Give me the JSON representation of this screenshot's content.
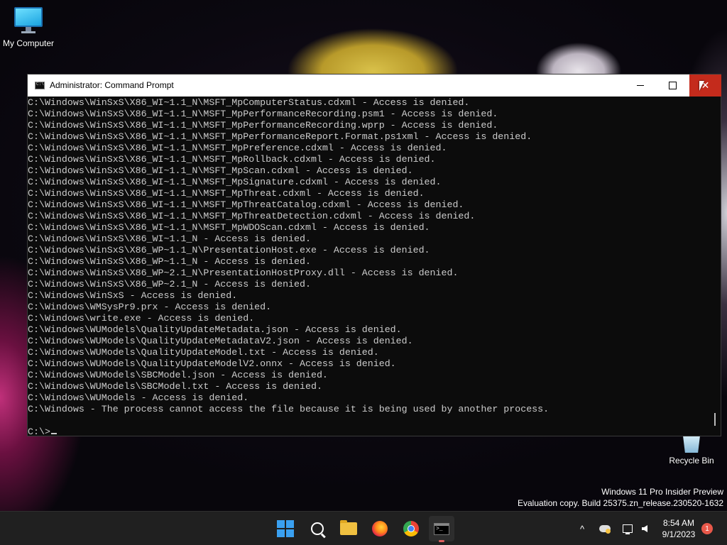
{
  "desktop": {
    "icons": [
      {
        "label": "My Computer"
      },
      {
        "label": "Recycle Bin"
      }
    ],
    "watermark": {
      "line1": "Windows 11 Pro Insider Preview",
      "line2": "Evaluation copy. Build 25375.zn_release.230520-1632"
    }
  },
  "window": {
    "title": "Administrator: Command Prompt",
    "console_lines": [
      "C:\\Windows\\WinSxS\\X86_WI~1.1_N\\MSFT_MpComputerStatus.cdxml - Access is denied.",
      "C:\\Windows\\WinSxS\\X86_WI~1.1_N\\MSFT_MpPerformanceRecording.psm1 - Access is denied.",
      "C:\\Windows\\WinSxS\\X86_WI~1.1_N\\MSFT_MpPerformanceRecording.wprp - Access is denied.",
      "C:\\Windows\\WinSxS\\X86_WI~1.1_N\\MSFT_MpPerformanceReport.Format.ps1xml - Access is denied.",
      "C:\\Windows\\WinSxS\\X86_WI~1.1_N\\MSFT_MpPreference.cdxml - Access is denied.",
      "C:\\Windows\\WinSxS\\X86_WI~1.1_N\\MSFT_MpRollback.cdxml - Access is denied.",
      "C:\\Windows\\WinSxS\\X86_WI~1.1_N\\MSFT_MpScan.cdxml - Access is denied.",
      "C:\\Windows\\WinSxS\\X86_WI~1.1_N\\MSFT_MpSignature.cdxml - Access is denied.",
      "C:\\Windows\\WinSxS\\X86_WI~1.1_N\\MSFT_MpThreat.cdxml - Access is denied.",
      "C:\\Windows\\WinSxS\\X86_WI~1.1_N\\MSFT_MpThreatCatalog.cdxml - Access is denied.",
      "C:\\Windows\\WinSxS\\X86_WI~1.1_N\\MSFT_MpThreatDetection.cdxml - Access is denied.",
      "C:\\Windows\\WinSxS\\X86_WI~1.1_N\\MSFT_MpWDOScan.cdxml - Access is denied.",
      "C:\\Windows\\WinSxS\\X86_WI~1.1_N - Access is denied.",
      "C:\\Windows\\WinSxS\\X86_WP~1.1_N\\PresentationHost.exe - Access is denied.",
      "C:\\Windows\\WinSxS\\X86_WP~1.1_N - Access is denied.",
      "C:\\Windows\\WinSxS\\X86_WP~2.1_N\\PresentationHostProxy.dll - Access is denied.",
      "C:\\Windows\\WinSxS\\X86_WP~2.1_N - Access is denied.",
      "C:\\Windows\\WinSxS - Access is denied.",
      "C:\\Windows\\WMSysPr9.prx - Access is denied.",
      "C:\\Windows\\write.exe - Access is denied.",
      "C:\\Windows\\WUModels\\QualityUpdateMetadata.json - Access is denied.",
      "C:\\Windows\\WUModels\\QualityUpdateMetadataV2.json - Access is denied.",
      "C:\\Windows\\WUModels\\QualityUpdateModel.txt - Access is denied.",
      "C:\\Windows\\WUModels\\QualityUpdateModelV2.onnx - Access is denied.",
      "C:\\Windows\\WUModels\\SBCModel.json - Access is denied.",
      "C:\\Windows\\WUModels\\SBCModel.txt - Access is denied.",
      "C:\\Windows\\WUModels - Access is denied.",
      "C:\\Windows - The process cannot access the file because it is being used by another process.",
      "",
      "C:\\>"
    ]
  },
  "taskbar": {
    "apps": [
      {
        "name": "start",
        "icon": "windows-logo-icon"
      },
      {
        "name": "search",
        "icon": "search-icon"
      },
      {
        "name": "file-explorer",
        "icon": "folder-icon"
      },
      {
        "name": "firefox",
        "icon": "firefox-icon"
      },
      {
        "name": "chrome",
        "icon": "chrome-icon"
      },
      {
        "name": "command-prompt",
        "icon": "terminal-icon",
        "active": true
      }
    ],
    "tray": {
      "chevron": "^",
      "time": "8:54 AM",
      "date": "9/1/2023",
      "notification_count": "1"
    }
  },
  "colors": {
    "accent_close": "#c42b1c",
    "console_bg": "#0c0c0c",
    "console_text": "#cccccc",
    "taskbar_bg": "#202020",
    "badge": "#e8584a"
  }
}
